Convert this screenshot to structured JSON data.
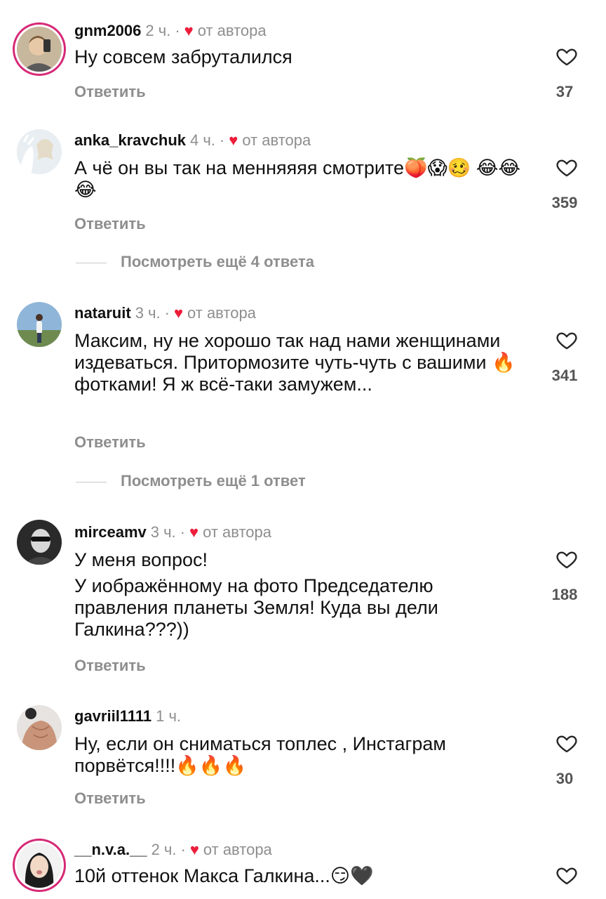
{
  "comments": [
    {
      "username": "gnm2006",
      "time": "2 ч.",
      "by_author": "от автора",
      "lines": [
        "Ну совсем забруталился"
      ],
      "reply_label": "Ответить",
      "likes": "37",
      "avatar_icon": "user-photo"
    },
    {
      "username": "anka_kravchuk",
      "time": "4 ч.",
      "by_author": "от автора",
      "lines": [
        "А чё он вы так на менняяяя смотрите🍑😱🥴 😂😂😂"
      ],
      "reply_label": "Ответить",
      "likes": "359",
      "more_replies": "Посмотреть ещё 4 ответа"
    },
    {
      "username": "nataruit",
      "time": "3 ч.",
      "by_author": "от автора",
      "lines": [
        "Максим, ну не хорошо так над нами женщинами издеваться. Притормозите чуть-чуть с вашими 🔥фотками! Я ж всё-таки замужем..."
      ],
      "reply_label": "Ответить",
      "likes": "341",
      "more_replies": "Посмотреть ещё 1 ответ"
    },
    {
      "username": "mirceamv",
      "time": "3 ч.",
      "by_author": "от автора",
      "lines": [
        "У меня вопрос!",
        "У иображённому на фото Председателю правления планеты Земля! Куда вы дели Галкина???))"
      ],
      "reply_label": "Ответить",
      "likes": "188"
    },
    {
      "username": "gavriil1111",
      "time": "1 ч.",
      "lines": [
        "Ну, если он сниматься топлес , Инстаграм порвётся!!!!🔥🔥🔥"
      ],
      "reply_label": "Ответить",
      "likes": "30"
    },
    {
      "username": "__n.v.a.__",
      "time": "2 ч.",
      "by_author": "от автора",
      "lines": [
        "10й оттенок Макса Галкина...😏🖤"
      ]
    }
  ],
  "colors": {
    "heart": "#ed1c3a",
    "muted": "#8e8e8e",
    "story_ring": "#d62976"
  },
  "icons": {
    "like": "heart-outline-icon",
    "author_like": "heart-filled-icon"
  }
}
